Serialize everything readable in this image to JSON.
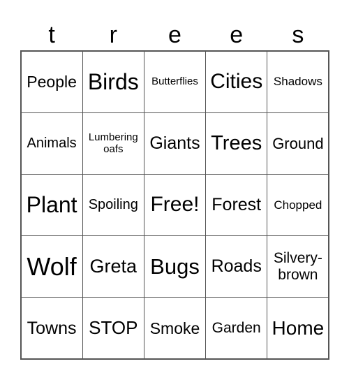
{
  "title_letters": [
    "t",
    "r",
    "e",
    "e",
    "s"
  ],
  "cells": [
    {
      "text": "People",
      "size": 23
    },
    {
      "text": "Birds",
      "size": 32
    },
    {
      "text": "Butterflies",
      "size": 15
    },
    {
      "text": "Cities",
      "size": 30
    },
    {
      "text": "Shadows",
      "size": 17
    },
    {
      "text": "Animals",
      "size": 20
    },
    {
      "text": "Lumbering oafs",
      "size": 15
    },
    {
      "text": "Giants",
      "size": 25
    },
    {
      "text": "Trees",
      "size": 29
    },
    {
      "text": "Ground",
      "size": 22
    },
    {
      "text": "Plant",
      "size": 32
    },
    {
      "text": "Spoiling",
      "size": 20
    },
    {
      "text": "Free!",
      "size": 30
    },
    {
      "text": "Forest",
      "size": 25
    },
    {
      "text": "Chopped",
      "size": 17
    },
    {
      "text": "Wolf",
      "size": 36
    },
    {
      "text": "Greta",
      "size": 27
    },
    {
      "text": "Bugs",
      "size": 31
    },
    {
      "text": "Roads",
      "size": 25
    },
    {
      "text": "Silvery-brown",
      "size": 21
    },
    {
      "text": "Towns",
      "size": 25
    },
    {
      "text": "STOP",
      "size": 26
    },
    {
      "text": "Smoke",
      "size": 23
    },
    {
      "text": "Garden",
      "size": 21
    },
    {
      "text": "Home",
      "size": 28
    }
  ]
}
